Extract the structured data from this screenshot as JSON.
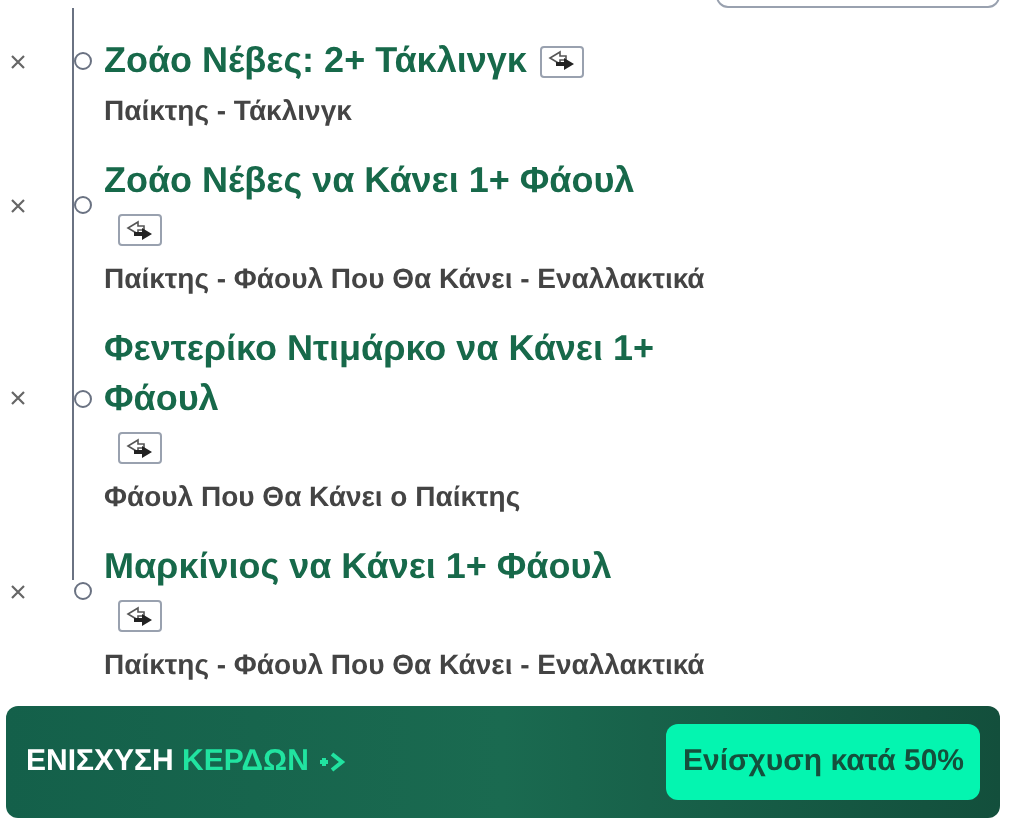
{
  "selections": [
    {
      "title": "Ζοάο Νέβες: 2+ Τάκλινγκ",
      "subtitle": "Παίκτης - Τάκλινγκ"
    },
    {
      "title": "Ζοάο Νέβες να Κάνει 1+ Φάουλ",
      "subtitle": "Παίκτης - Φάουλ Που Θα Κάνει - Εναλλακτικά"
    },
    {
      "title": "Φεντερίκο Ντιμάρκο να Κάνει 1+ Φάουλ",
      "subtitle": "Φάουλ Που Θα Κάνει ο Παίκτης"
    },
    {
      "title": "Μαρκίνιος να Κάνει 1+ Φάουλ",
      "subtitle": "Παίκτης - Φάουλ Που Θα Κάνει - Εναλλακτικά"
    }
  ],
  "boost_banner": {
    "label": "ΕΝΙΣΧΥΣΗ",
    "label_highlight": "ΚΕΡΔΩΝ",
    "button": "Ενίσχυση κατά 50%"
  }
}
